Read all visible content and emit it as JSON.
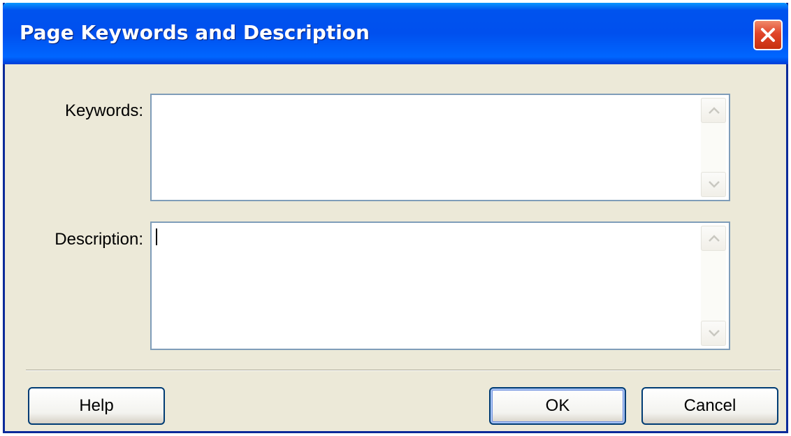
{
  "window": {
    "title": "Page Keywords and Description",
    "close_icon": "close-x-icon",
    "colors": {
      "title_bar": "#0054e3",
      "close_button": "#e0452a",
      "dialog_background": "#ece9d8",
      "field_border": "#7f9db9",
      "button_border": "#003c74"
    }
  },
  "fields": {
    "keywords": {
      "label": "Keywords:",
      "value": ""
    },
    "description": {
      "label": "Description:",
      "value": "",
      "focused": true
    }
  },
  "buttons": {
    "help_label": "Help",
    "ok_label": "OK",
    "cancel_label": "Cancel"
  },
  "icons": {
    "scroll_up": "chevron-up-icon",
    "scroll_down": "chevron-down-icon"
  }
}
